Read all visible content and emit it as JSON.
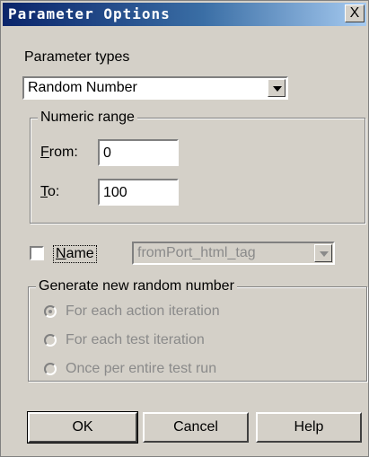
{
  "window": {
    "title": "Parameter Options",
    "close_glyph": "X"
  },
  "parameter_types": {
    "label": "Parameter types",
    "selected": "Random Number"
  },
  "numeric_range": {
    "legend": "Numeric range",
    "from_label": "From:",
    "from_value": "0",
    "to_label": "To:",
    "to_value": "100"
  },
  "name": {
    "label": "Name",
    "checked": false,
    "selected": "fromPort_html_tag",
    "enabled": false
  },
  "generate": {
    "legend": "Generate new random number",
    "options": [
      {
        "label": "For each action iteration",
        "selected": true
      },
      {
        "label": "For each test iteration",
        "selected": false
      },
      {
        "label": "Once per entire test run",
        "selected": false
      }
    ]
  },
  "buttons": {
    "ok": "OK",
    "cancel": "Cancel",
    "help": "Help"
  }
}
